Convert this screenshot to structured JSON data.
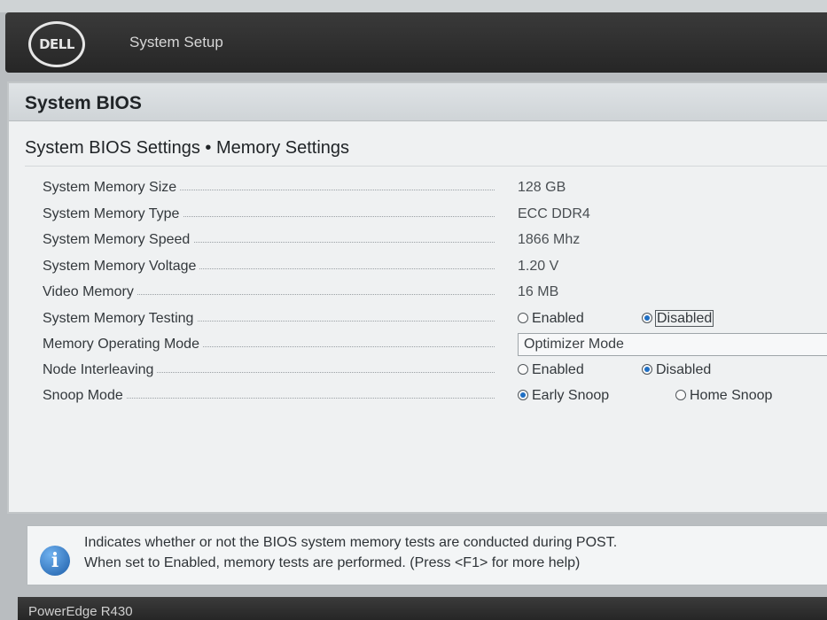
{
  "header": {
    "logo_text": "DELL",
    "title": "System Setup"
  },
  "panel": {
    "heading": "System BIOS",
    "subtitle": "System BIOS Settings • Memory Settings"
  },
  "rows": [
    {
      "label": "System Memory Size",
      "value": "128 GB"
    },
    {
      "label": "System Memory Type",
      "value": "ECC DDR4"
    },
    {
      "label": "System Memory Speed",
      "value": "1866 Mhz"
    },
    {
      "label": "System Memory Voltage",
      "value": "1.20 V"
    },
    {
      "label": "Video Memory",
      "value": "16 MB"
    },
    {
      "label": "System Memory Testing",
      "options": [
        "Enabled",
        "Disabled"
      ],
      "selected": "Disabled"
    },
    {
      "label": "Memory Operating Mode",
      "value": "Optimizer Mode"
    },
    {
      "label": "Node Interleaving",
      "options": [
        "Enabled",
        "Disabled"
      ],
      "selected": "Disabled"
    },
    {
      "label": "Snoop Mode",
      "options": [
        "Early Snoop",
        "Home Snoop"
      ],
      "selected": "Early Snoop"
    }
  ],
  "help": {
    "line1": "Indicates whether or not the BIOS system memory tests are conducted during POST.",
    "line2": "When set to Enabled, memory tests are performed. (Press <F1> for more help)"
  },
  "footer": {
    "model": "PowerEdge R430"
  },
  "colors": {
    "header_bg": "#2e2e2e",
    "panel_bg": "#eff1f2",
    "radio_selected": "#1f6fc4",
    "info_icon": "#1d5ea9"
  }
}
